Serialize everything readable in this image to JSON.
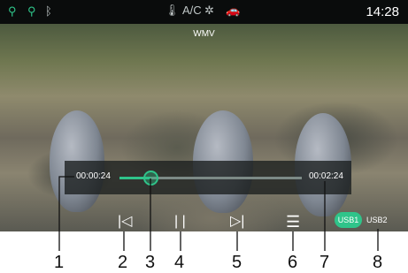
{
  "statusbar": {
    "icons": [
      "usb-icon",
      "usb-icon",
      "bluetooth-icon"
    ],
    "thermometer_icon": "thermometer-icon",
    "ac_label": "A/C",
    "fan_icon": "fan-icon",
    "car_icon": "car-icon",
    "time": "14:28"
  },
  "video": {
    "title": "WMV"
  },
  "player": {
    "elapsed": "00:00:24",
    "total": "00:02:24",
    "progress": 0.17
  },
  "controls": {
    "prev_icon": "skip-previous-icon",
    "pause_icon": "pause-icon",
    "next_icon": "skip-next-icon",
    "playlist_icon": "playlist-icon",
    "usb1_label": "USB1",
    "usb2_label": "USB2"
  },
  "callouts": [
    "1",
    "2",
    "3",
    "4",
    "5",
    "6",
    "7",
    "8"
  ],
  "colors": {
    "accent": "#2fc48a",
    "background": "#0d0f0f",
    "text": "#ffffff"
  }
}
